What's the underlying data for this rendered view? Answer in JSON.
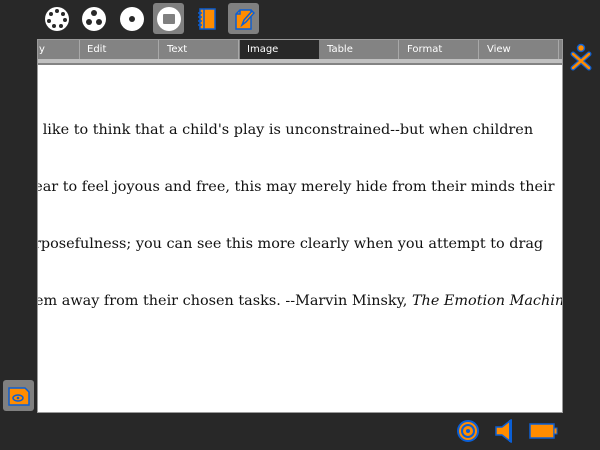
{
  "frame": {
    "top_icons": [
      {
        "name": "neighborhood-view-icon"
      },
      {
        "name": "group-view-icon"
      },
      {
        "name": "home-view-icon"
      },
      {
        "name": "activity-view-icon",
        "selected": true
      },
      {
        "name": "journal-icon"
      },
      {
        "name": "write-activity-icon",
        "selected": true
      }
    ],
    "colors": {
      "accent_orange": "#ff8c00",
      "accent_blue": "#0a5fd6",
      "frame_bg": "#282828"
    }
  },
  "toolbar": {
    "tabs": [
      {
        "label": "y"
      },
      {
        "label": "Edit"
      },
      {
        "label": "Text"
      },
      {
        "label": "Image",
        "active": true
      },
      {
        "label": "Table"
      },
      {
        "label": "Format"
      },
      {
        "label": "View"
      }
    ]
  },
  "document": {
    "lines": [
      "We like to think that a child's play is unconstrained--but when children",
      "pear to feel joyous and free, this may merely hide from their minds their",
      "rposefulness; you can see this more clearly when you attempt to drag",
      "em away from their chosen tasks. --Marvin Minsky, "
    ],
    "citation_title": "The Emotion Machine"
  }
}
